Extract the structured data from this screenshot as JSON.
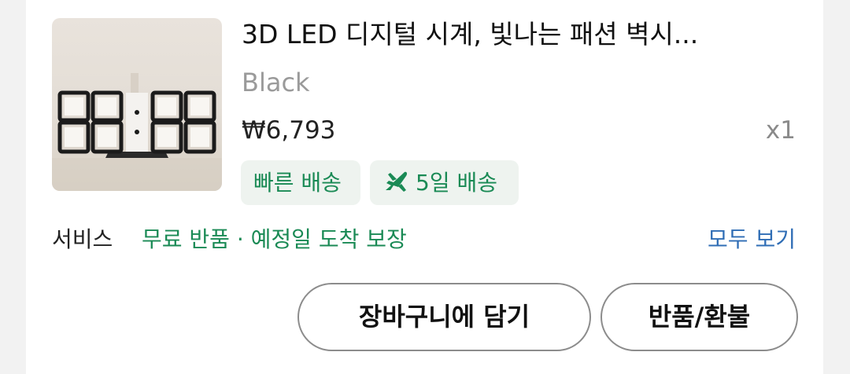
{
  "product": {
    "title": "3D LED 디지털 시계, 빛나는 패션 벽시...",
    "option": "Black",
    "price": "₩6,793",
    "quantity": "x1",
    "image_icon": "led-digital-clock-icon"
  },
  "badges": {
    "fast_delivery": "빠른 배송",
    "days_delivery": "5일 배송",
    "days_delivery_icon": "airplane-icon"
  },
  "service": {
    "label": "서비스",
    "value": "무료 반품 · 예정일 도착 보장",
    "see_all": "모두 보기"
  },
  "actions": {
    "add_to_cart": "장바구니에 담기",
    "return_refund": "반품/환불"
  },
  "colors": {
    "accent_green": "#1a8a55",
    "link_blue": "#2f6db5",
    "badge_bg": "#eef3ef"
  }
}
